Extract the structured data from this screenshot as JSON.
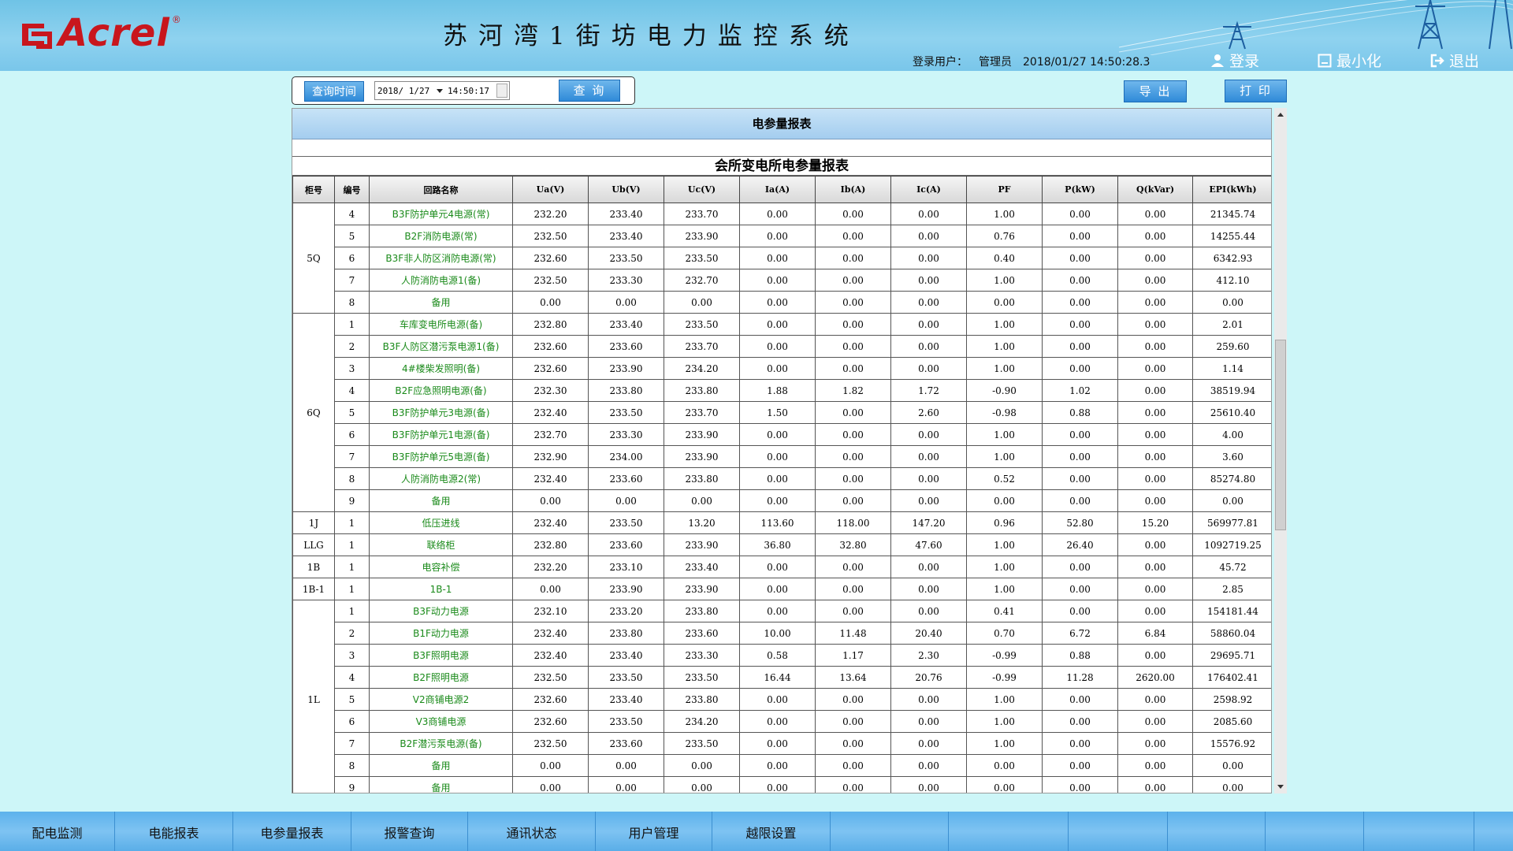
{
  "header": {
    "brand": "Acrel",
    "brand_reg": "®",
    "system_title": "苏河湾1街坊电力监控系统",
    "login_user_label": "登录用户：",
    "login_user": "管理员",
    "datetime": "2018/01/27  14:50:28.3",
    "login_btn": "登录",
    "minimize_btn": "最小化",
    "exit_btn": "退出"
  },
  "query": {
    "time_label": "查询时间",
    "date_value": "2018/ 1/27",
    "time_value": "14:50:17",
    "query_btn": "查 询"
  },
  "actions": {
    "export_btn": "导 出",
    "print_btn": "打 印"
  },
  "report": {
    "title": "电参量报表",
    "subtitle": "会所变电所电参量报表",
    "columns": [
      "柜号",
      "编号",
      "回路名称",
      "Ua(V)",
      "Ub(V)",
      "Uc(V)",
      "Ia(A)",
      "Ib(A)",
      "Ic(A)",
      "PF",
      "P(kW)",
      "Q(kVar)",
      "EPI(kWh)"
    ],
    "groups": [
      {
        "cabinet": "5Q",
        "rows": [
          [
            "4",
            "B3F防护单元4电源(常)",
            "232.20",
            "233.40",
            "233.70",
            "0.00",
            "0.00",
            "0.00",
            "1.00",
            "0.00",
            "0.00",
            "21345.74"
          ],
          [
            "5",
            "B2F消防电源(常)",
            "232.50",
            "233.40",
            "233.90",
            "0.00",
            "0.00",
            "0.00",
            "0.76",
            "0.00",
            "0.00",
            "14255.44"
          ],
          [
            "6",
            "B3F非人防区消防电源(常)",
            "232.60",
            "233.50",
            "233.50",
            "0.00",
            "0.00",
            "0.00",
            "0.40",
            "0.00",
            "0.00",
            "6342.93"
          ],
          [
            "7",
            "人防消防电源1(备)",
            "232.50",
            "233.30",
            "232.70",
            "0.00",
            "0.00",
            "0.00",
            "1.00",
            "0.00",
            "0.00",
            "412.10"
          ],
          [
            "8",
            "备用",
            "0.00",
            "0.00",
            "0.00",
            "0.00",
            "0.00",
            "0.00",
            "0.00",
            "0.00",
            "0.00",
            "0.00"
          ]
        ]
      },
      {
        "cabinet": "6Q",
        "rows": [
          [
            "1",
            "车库变电所电源(备)",
            "232.80",
            "233.40",
            "233.50",
            "0.00",
            "0.00",
            "0.00",
            "1.00",
            "0.00",
            "0.00",
            "2.01"
          ],
          [
            "2",
            "B3F人防区潜污泵电源1(备)",
            "232.60",
            "233.60",
            "233.70",
            "0.00",
            "0.00",
            "0.00",
            "1.00",
            "0.00",
            "0.00",
            "259.60"
          ],
          [
            "3",
            "4#楼柴发照明(备)",
            "232.60",
            "233.90",
            "234.20",
            "0.00",
            "0.00",
            "0.00",
            "1.00",
            "0.00",
            "0.00",
            "1.14"
          ],
          [
            "4",
            "B2F应急照明电源(备)",
            "232.30",
            "233.80",
            "233.80",
            "1.88",
            "1.82",
            "1.72",
            "-0.90",
            "1.02",
            "0.00",
            "38519.94"
          ],
          [
            "5",
            "B3F防护单元3电源(备)",
            "232.40",
            "233.50",
            "233.70",
            "1.50",
            "0.00",
            "2.60",
            "-0.98",
            "0.88",
            "0.00",
            "25610.40"
          ],
          [
            "6",
            "B3F防护单元1电源(备)",
            "232.70",
            "233.30",
            "233.90",
            "0.00",
            "0.00",
            "0.00",
            "1.00",
            "0.00",
            "0.00",
            "4.00"
          ],
          [
            "7",
            "B3F防护单元5电源(备)",
            "232.90",
            "234.00",
            "233.90",
            "0.00",
            "0.00",
            "0.00",
            "1.00",
            "0.00",
            "0.00",
            "3.60"
          ],
          [
            "8",
            "人防消防电源2(常)",
            "232.40",
            "233.60",
            "233.80",
            "0.00",
            "0.00",
            "0.00",
            "0.52",
            "0.00",
            "0.00",
            "85274.80"
          ],
          [
            "9",
            "备用",
            "0.00",
            "0.00",
            "0.00",
            "0.00",
            "0.00",
            "0.00",
            "0.00",
            "0.00",
            "0.00",
            "0.00"
          ]
        ]
      },
      {
        "cabinet": "1J",
        "rows": [
          [
            "1",
            "低压进线",
            "232.40",
            "233.50",
            "13.20",
            "113.60",
            "118.00",
            "147.20",
            "0.96",
            "52.80",
            "15.20",
            "569977.81"
          ]
        ]
      },
      {
        "cabinet": "LLG",
        "rows": [
          [
            "1",
            "联络柜",
            "232.80",
            "233.60",
            "233.90",
            "36.80",
            "32.80",
            "47.60",
            "1.00",
            "26.40",
            "0.00",
            "1092719.25"
          ]
        ]
      },
      {
        "cabinet": "1B",
        "rows": [
          [
            "1",
            "电容补偿",
            "232.20",
            "233.10",
            "233.40",
            "0.00",
            "0.00",
            "0.00",
            "1.00",
            "0.00",
            "0.00",
            "45.72"
          ]
        ]
      },
      {
        "cabinet": "1B-1",
        "rows": [
          [
            "1",
            "1B-1",
            "0.00",
            "233.90",
            "233.90",
            "0.00",
            "0.00",
            "0.00",
            "1.00",
            "0.00",
            "0.00",
            "2.85"
          ]
        ]
      },
      {
        "cabinet": "1L",
        "rows": [
          [
            "1",
            "B3F动力电源",
            "232.10",
            "233.20",
            "233.80",
            "0.00",
            "0.00",
            "0.00",
            "0.41",
            "0.00",
            "0.00",
            "154181.44"
          ],
          [
            "2",
            "B1F动力电源",
            "232.40",
            "233.80",
            "233.60",
            "10.00",
            "11.48",
            "20.40",
            "0.70",
            "6.72",
            "6.84",
            "58860.04"
          ],
          [
            "3",
            "B3F照明电源",
            "232.40",
            "233.40",
            "233.30",
            "0.58",
            "1.17",
            "2.30",
            "-0.99",
            "0.88",
            "0.00",
            "29695.71"
          ],
          [
            "4",
            "B2F照明电源",
            "232.50",
            "233.50",
            "233.50",
            "16.44",
            "13.64",
            "20.76",
            "-0.99",
            "11.28",
            "2620.00",
            "176402.41"
          ],
          [
            "5",
            "V2商铺电源2",
            "232.60",
            "233.40",
            "233.80",
            "0.00",
            "0.00",
            "0.00",
            "1.00",
            "0.00",
            "0.00",
            "2598.92"
          ],
          [
            "6",
            "V3商铺电源",
            "232.60",
            "233.50",
            "234.20",
            "0.00",
            "0.00",
            "0.00",
            "1.00",
            "0.00",
            "0.00",
            "2085.60"
          ],
          [
            "7",
            "B2F潜污泵电源(备)",
            "232.50",
            "233.60",
            "233.50",
            "0.00",
            "0.00",
            "0.00",
            "1.00",
            "0.00",
            "0.00",
            "15576.92"
          ],
          [
            "8",
            "备用",
            "0.00",
            "0.00",
            "0.00",
            "0.00",
            "0.00",
            "0.00",
            "0.00",
            "0.00",
            "0.00",
            "0.00"
          ],
          [
            "9",
            "备用",
            "0.00",
            "0.00",
            "0.00",
            "0.00",
            "0.00",
            "0.00",
            "0.00",
            "0.00",
            "0.00",
            "0.00"
          ]
        ]
      }
    ]
  },
  "nav": {
    "items": [
      "配电监测",
      "电能报表",
      "电参量报表",
      "报警查询",
      "通讯状态",
      "用户管理",
      "越限设置",
      "",
      "",
      "",
      "",
      "",
      ""
    ]
  },
  "colors": {
    "brand_red": "#c8161d",
    "circuit_name_green": "#1a8a1a",
    "page_bg": "#cdf6f8",
    "header_blue": "#79c6ea",
    "button_blue": "#2f8ad8"
  }
}
